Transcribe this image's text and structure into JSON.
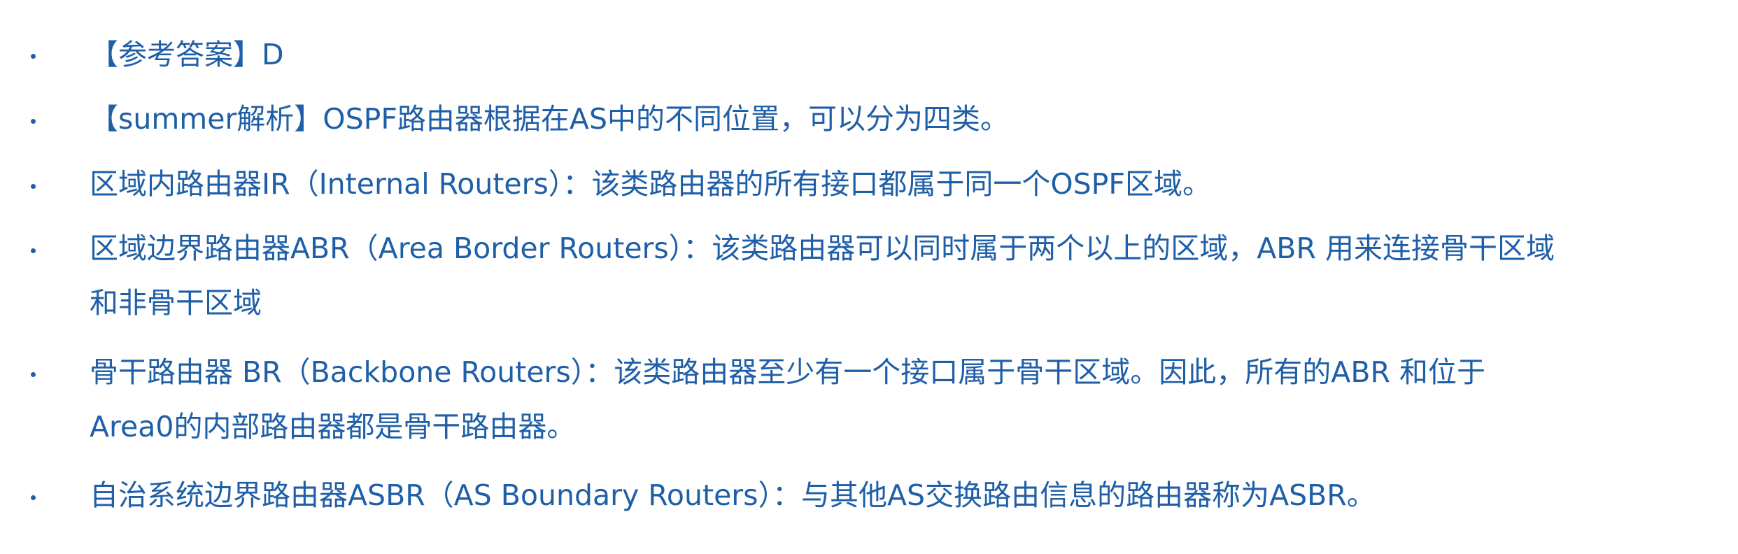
{
  "bullets": [
    {
      "text": "【参考答案】D"
    },
    {
      "text": "【summer解析】OSPF路由器根据在AS中的不同位置，可以分为四类。"
    },
    {
      "text": "区域内路由器IR（Internal Routers）：该类路由器的所有接口都属于同一个OSPF区域。"
    },
    {
      "line1": "区域边界路由器ABR（Area Border Routers）：该类路由器可以同时属于两个以上的区域，ABR 用来连接骨干区域",
      "line2": "和非骨干区域"
    },
    {
      "line1": "骨干路由器 BR（Backbone Routers）：该类路由器至少有一个接口属于骨干区域。因此，所有的ABR 和位于",
      "line2": "Area0的内部路由器都是骨干路由器。"
    },
    {
      "text": "自治系统边界路由器ASBR（AS Boundary Routers）：与其他AS交换路由信息的路由器称为ASBR。"
    }
  ]
}
